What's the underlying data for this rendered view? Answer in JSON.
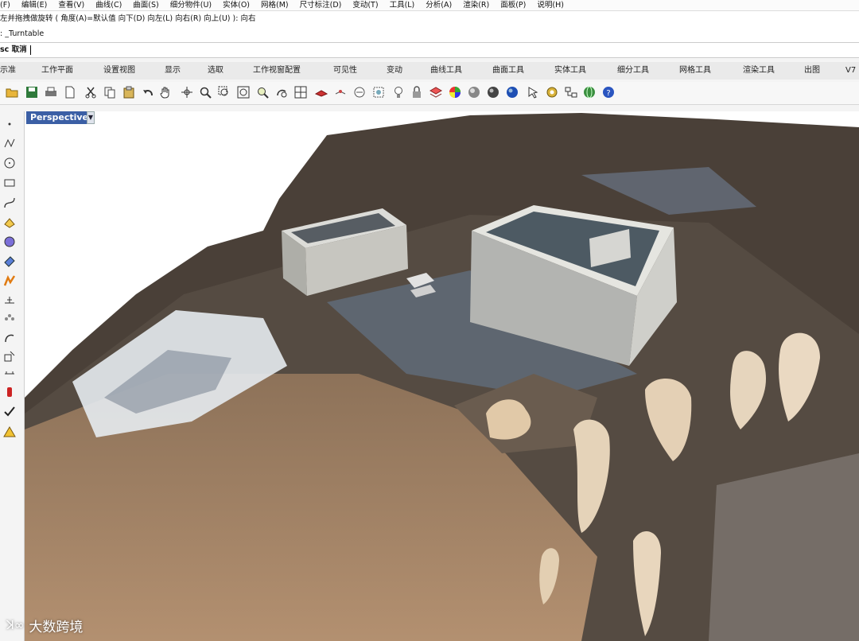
{
  "menu": [
    "(F)",
    "编辑(E)",
    "查看(V)",
    "曲线(C)",
    "曲面(S)",
    "细分物件(U)",
    "实体(O)",
    "网格(M)",
    "尺寸标注(D)",
    "变动(T)",
    "工具(L)",
    "分析(A)",
    "渲染(R)",
    "面板(P)",
    "说明(H)"
  ],
  "command": {
    "history1": "左并拖拽做旋转 ( 角度(A)=默认值  向下(D)  向左(L)  向右(R)  向上(U) ): 向右",
    "history2": ": _Turntable",
    "prompt_label": "sc 取消"
  },
  "tabs": [
    "示准",
    "工作平面",
    "设置视图",
    "显示",
    "选取",
    "工作视窗配置",
    "可见性",
    "变动",
    "曲线工具",
    "曲面工具",
    "实体工具",
    "细分工具",
    "网格工具",
    "渲染工具",
    "出图",
    "V7"
  ],
  "viewport": {
    "label": "Perspective",
    "dropdown": "▼"
  },
  "watermark": {
    "logo": "ꓘ∞",
    "text": "大数跨境"
  },
  "colors": {
    "tab_active": "#3b5fa5",
    "sand": "#b8926c",
    "snow": "#dfe6ee"
  }
}
